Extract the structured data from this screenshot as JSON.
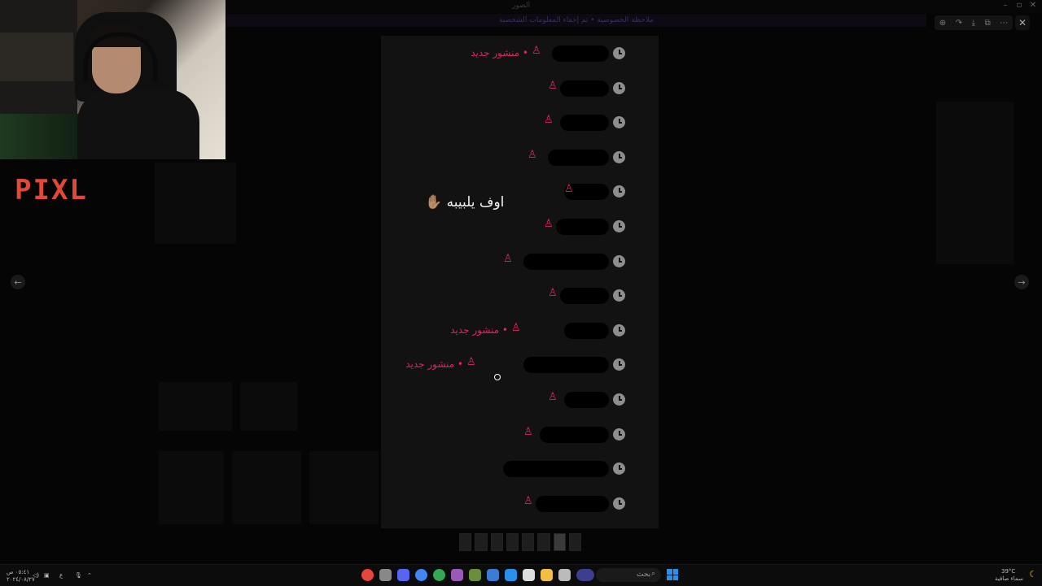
{
  "window": {
    "title": "الصور",
    "controls": [
      "minimize-icon",
      "maximize-icon",
      "close-icon"
    ]
  },
  "banner": {
    "text": "ملاحظة الخصوصية • تم إخفاء المعلومات الشخصية"
  },
  "viewer_toolbar": {
    "icons": [
      "zoom-icon",
      "rotate-icon",
      "download-icon",
      "open-external-icon",
      "more-icon"
    ]
  },
  "overlay": {
    "logo": "PIXL",
    "annotation": "اوف يلبيبه",
    "annotation_emoji": "✋🏽"
  },
  "notifications": [
    {
      "has_new_post": true,
      "new_post_label": "• منشور جديد",
      "has_user_icon": true
    },
    {
      "has_new_post": false,
      "new_post_label": "",
      "has_user_icon": true
    },
    {
      "has_new_post": false,
      "new_post_label": "",
      "has_user_icon": true
    },
    {
      "has_new_post": false,
      "new_post_label": "",
      "has_user_icon": true
    },
    {
      "has_new_post": false,
      "new_post_label": "",
      "has_user_icon": true
    },
    {
      "has_new_post": false,
      "new_post_label": "",
      "has_user_icon": true
    },
    {
      "has_new_post": false,
      "new_post_label": "",
      "has_user_icon": true
    },
    {
      "has_new_post": false,
      "new_post_label": "",
      "has_user_icon": true
    },
    {
      "has_new_post": true,
      "new_post_label": "• منشور جديد",
      "has_user_icon": true
    },
    {
      "has_new_post": true,
      "new_post_label": "• منشور جديد",
      "has_user_icon": true
    },
    {
      "has_new_post": false,
      "new_post_label": "",
      "has_user_icon": true
    },
    {
      "has_new_post": false,
      "new_post_label": "",
      "has_user_icon": true
    },
    {
      "has_new_post": false,
      "new_post_label": "",
      "has_user_icon": false
    },
    {
      "has_new_post": false,
      "new_post_label": "",
      "has_user_icon": true
    }
  ],
  "nav": {
    "prev_icon": "arrow-left-icon",
    "next_icon": "arrow-right-icon"
  },
  "thumbnails": {
    "count": 8,
    "selected_index": 6
  },
  "taskbar": {
    "search_placeholder": "بحث",
    "apps": [
      "chrome-icon",
      "settings-icon",
      "discord-icon",
      "chrome-icon",
      "chrome-icon",
      "game-icon",
      "minecraft-icon",
      "photos-icon",
      "edge-icon",
      "calendar-icon",
      "folder-icon",
      "window-icon"
    ],
    "clock_time": "٠٥:٤١ ص",
    "clock_date": "٢٠٢٤/٠٨/٢٧",
    "weather_temp": "39°C",
    "weather_desc": "سماء صافية",
    "language": "ع"
  },
  "colors": {
    "accent_pink": "#e0245e",
    "viewer_bg": "#121212",
    "page_bg": "#050505",
    "logo_red": "#e2483a"
  }
}
